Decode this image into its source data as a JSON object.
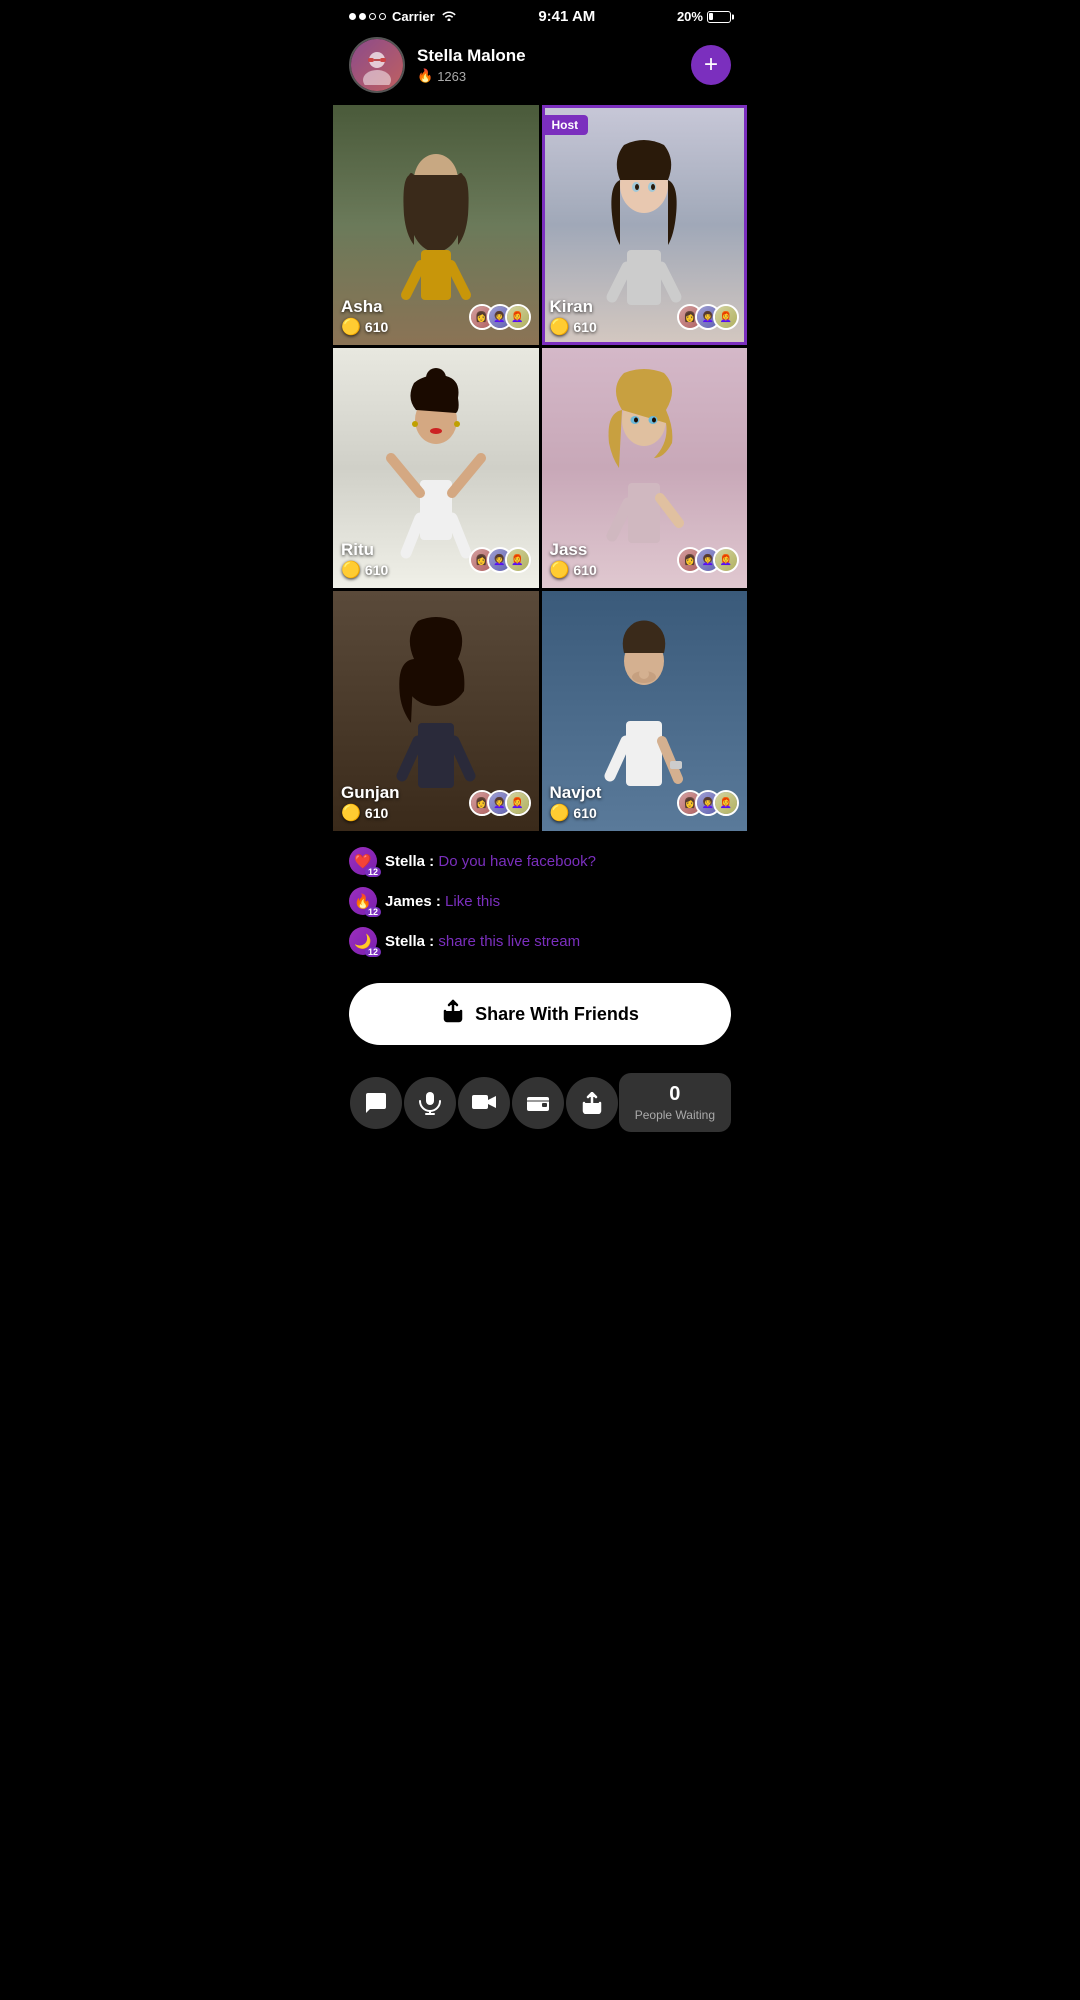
{
  "statusBar": {
    "carrier": "Carrier",
    "time": "9:41 AM",
    "battery": "20%"
  },
  "profile": {
    "name": "Stella Malone",
    "score": "1263",
    "followLabel": "+",
    "emoji": "👩"
  },
  "grid": {
    "cells": [
      {
        "id": "asha",
        "name": "Asha",
        "coins": "610",
        "isHost": false,
        "bg": "bg-asha",
        "emoji": "👩‍🦱"
      },
      {
        "id": "kiran",
        "name": "Kiran",
        "coins": "610",
        "isHost": true,
        "hostLabel": "Host",
        "bg": "bg-kiran",
        "emoji": "👩"
      },
      {
        "id": "ritu",
        "name": "Ritu",
        "coins": "610",
        "isHost": false,
        "bg": "bg-ritu",
        "emoji": "👩‍🦰"
      },
      {
        "id": "jass",
        "name": "Jass",
        "coins": "610",
        "isHost": false,
        "bg": "bg-jass",
        "emoji": "👱‍♀️"
      },
      {
        "id": "gunjan",
        "name": "Gunjan",
        "coins": "610",
        "isHost": false,
        "bg": "bg-gunjan",
        "emoji": "👩‍🦫"
      },
      {
        "id": "navjot",
        "name": "Navjot",
        "coins": "610",
        "isHost": false,
        "bg": "bg-navjot",
        "emoji": "👨"
      }
    ]
  },
  "chat": {
    "messages": [
      {
        "user": "Stella",
        "text": "Do you have facebook?",
        "badge": "❤️",
        "badgeNum": "12"
      },
      {
        "user": "James",
        "text": "Like this",
        "badge": "🔥",
        "badgeNum": "12"
      },
      {
        "user": "Stella",
        "text": "share this live stream",
        "badge": "🌙",
        "badgeNum": "12"
      }
    ]
  },
  "shareBtn": {
    "label": "Share With Friends"
  },
  "bottomBar": {
    "buttons": [
      {
        "id": "chat",
        "icon": "💬"
      },
      {
        "id": "mic",
        "icon": "🎤"
      },
      {
        "id": "video",
        "icon": "📹"
      },
      {
        "id": "wallet",
        "icon": "👜"
      },
      {
        "id": "share",
        "icon": "↗"
      }
    ],
    "peopleWaiting": {
      "count": "0",
      "label": "People Waiting"
    }
  },
  "colors": {
    "accent": "#7B2FBE",
    "coinColor": "#F5A623"
  }
}
